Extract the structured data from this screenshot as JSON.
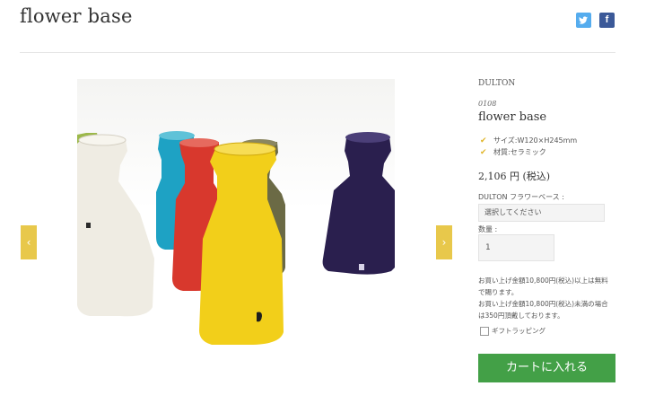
{
  "page": {
    "title": "flower base"
  },
  "social": {
    "twitter_icon": "twitter-icon",
    "facebook_icon": "facebook-icon",
    "facebook_glyph": "f"
  },
  "gallery": {
    "prev_glyph": "‹",
    "next_glyph": "›",
    "image_label": "Ceramic flower vases in white, turquoise, red, yellow, olive and navy",
    "colors": {
      "yellow_arrow": "#e8c84b"
    }
  },
  "product": {
    "brand": "DULTON",
    "sku": "0108",
    "name": "flower base",
    "features": [
      "サイズ:W120×H245mm",
      "材質:セラミック"
    ],
    "price": "2,106 円 (税込)",
    "option_label": "DULTON フラワーベース :",
    "option_selected": "選択してください",
    "qty_label": "数量 :",
    "qty_value": "1",
    "shipping_notes": [
      "お買い上げ金額10,800円(税込)以上は無料",
      "で賜ります。",
      "お買い上げ金額10,800円(税込)未満の場合",
      "は350円頂戴しております。"
    ],
    "gift_label": "ギフトラッピング",
    "cart_label": "カートに入れる",
    "colors": {
      "cart": "#43a047",
      "check": "#e0b52a"
    }
  }
}
